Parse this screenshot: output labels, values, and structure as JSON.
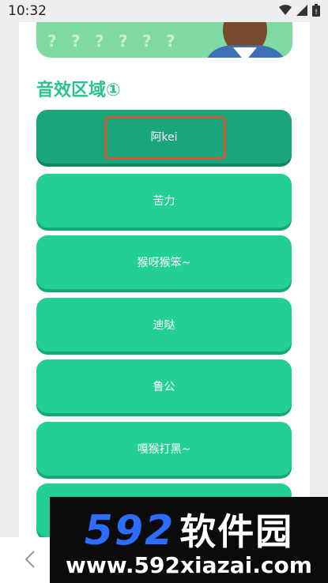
{
  "status_bar": {
    "time": "10:32"
  },
  "banner": {
    "pattern_glyph": "?"
  },
  "section": {
    "title": "音效区域①"
  },
  "sound_buttons": [
    {
      "label": "阿kei",
      "selected": true
    },
    {
      "label": "苦力",
      "selected": false
    },
    {
      "label": "猴呀猴笨~",
      "selected": false
    },
    {
      "label": "迪哒",
      "selected": false
    },
    {
      "label": "鲁公",
      "selected": false
    },
    {
      "label": "嘎猴打黑~",
      "selected": false
    },
    {
      "label": "",
      "selected": false
    }
  ],
  "watermark": {
    "brand": "592",
    "name": "软件园",
    "url": "www.592xiazai.com"
  },
  "colors": {
    "accent": "#23cf96",
    "accent_dark": "#1ba57b",
    "title": "#28c28f",
    "highlight": "#d15a3c"
  },
  "icons": {
    "wifi": "wifi-icon",
    "signal": "signal-icon",
    "battery": "battery-icon",
    "back": "back-chevron-icon"
  }
}
